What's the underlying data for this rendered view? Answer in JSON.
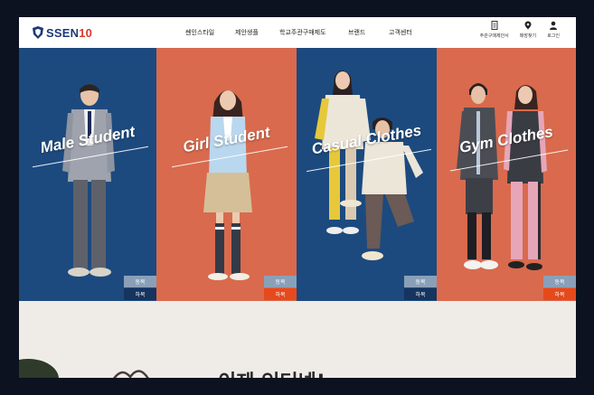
{
  "brand": {
    "name": "SSEN",
    "suffix": "10",
    "shield_color": "#1d3a7a",
    "accent": "#d83a2b"
  },
  "nav": [
    "쎈인스타일",
    "제안생플",
    "학교주관구매제도",
    "브랜드",
    "고객센터"
  ],
  "utility": [
    {
      "icon": "document-icon",
      "label": "주관구매제안서"
    },
    {
      "icon": "location-pin-icon",
      "label": "매장찾기"
    },
    {
      "icon": "person-icon",
      "label": "로그인"
    }
  ],
  "panels": [
    {
      "title": "Male Student",
      "bg": "#1c4a7f",
      "winter": "동복",
      "summer": "하복",
      "summer_color": "#16345e"
    },
    {
      "title": "Girl Student",
      "bg": "#d96a4d",
      "winter": "동복",
      "summer": "하복",
      "summer_color": "#e54a1c"
    },
    {
      "title": "Casual Clothes",
      "bg": "#1c4a7f",
      "winter": "동복",
      "summer": "하복",
      "summer_color": "#16345e"
    },
    {
      "title": "Gym Clothes",
      "bg": "#d96a4d",
      "winter": "동복",
      "summer": "하복",
      "summer_color": "#e54a1c"
    }
  ],
  "lower": {
    "headline": "이제 인터넷!"
  }
}
